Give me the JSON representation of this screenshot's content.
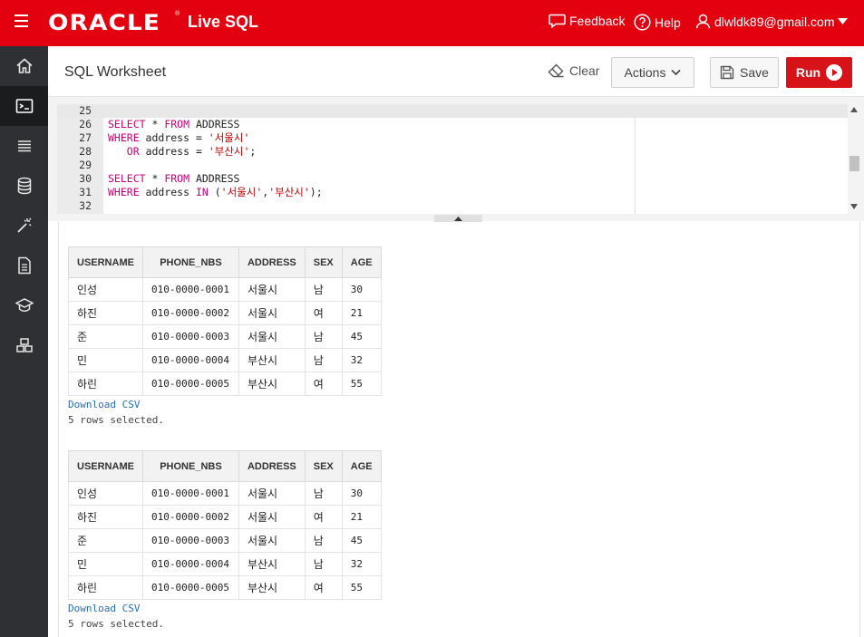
{
  "topbar": {
    "brand": "ORACLE",
    "brand_reg": "®",
    "product": "Live SQL",
    "feedback": "Feedback",
    "help": "Help",
    "user": "dlwldk89@gmail.com"
  },
  "sidebar": {
    "items": [
      {
        "name": "home",
        "icon": "home-icon"
      },
      {
        "name": "sql-worksheet",
        "icon": "terminal-icon",
        "active": true
      },
      {
        "name": "my-session",
        "icon": "list-icon"
      },
      {
        "name": "schema",
        "icon": "database-icon"
      },
      {
        "name": "quick-sql",
        "icon": "magic-wand-icon"
      },
      {
        "name": "my-scripts",
        "icon": "document-icon"
      },
      {
        "name": "tutorials",
        "icon": "graduation-cap-icon"
      },
      {
        "name": "code-library",
        "icon": "blocks-icon"
      }
    ]
  },
  "header": {
    "title": "SQL Worksheet",
    "clear": "Clear",
    "actions": "Actions",
    "save": "Save",
    "run": "Run"
  },
  "editor": {
    "lines": [
      {
        "num": "25",
        "code": ""
      },
      {
        "num": "26",
        "code": "SELECT * FROM ADDRESS"
      },
      {
        "num": "27",
        "code": "WHERE address = '서울시'"
      },
      {
        "num": "28",
        "code": "   OR address = '부산시';"
      },
      {
        "num": "29",
        "code": ""
      },
      {
        "num": "30",
        "code": "SELECT * FROM ADDRESS"
      },
      {
        "num": "31",
        "code": "WHERE address IN ('서울시','부산시');"
      },
      {
        "num": "32",
        "code": ""
      }
    ]
  },
  "results": [
    {
      "columns": [
        "USERNAME",
        "PHONE_NBS",
        "ADDRESS",
        "SEX",
        "AGE"
      ],
      "rows": [
        [
          "인성",
          "010-0000-0001",
          "서울시",
          "남",
          "30"
        ],
        [
          "하진",
          "010-0000-0002",
          "서울시",
          "여",
          "21"
        ],
        [
          "준",
          "010-0000-0003",
          "서울시",
          "남",
          "45"
        ],
        [
          "민",
          "010-0000-0004",
          "부산시",
          "남",
          "32"
        ],
        [
          "하린",
          "010-0000-0005",
          "부산시",
          "여",
          "55"
        ]
      ],
      "download": "Download CSV",
      "message": "5 rows selected."
    },
    {
      "columns": [
        "USERNAME",
        "PHONE_NBS",
        "ADDRESS",
        "SEX",
        "AGE"
      ],
      "rows": [
        [
          "인성",
          "010-0000-0001",
          "서울시",
          "남",
          "30"
        ],
        [
          "하진",
          "010-0000-0002",
          "서울시",
          "여",
          "21"
        ],
        [
          "준",
          "010-0000-0003",
          "서울시",
          "남",
          "45"
        ],
        [
          "민",
          "010-0000-0004",
          "부산시",
          "남",
          "32"
        ],
        [
          "하린",
          "010-0000-0005",
          "부산시",
          "여",
          "55"
        ]
      ],
      "download": "Download CSV",
      "message": "5 rows selected."
    }
  ],
  "colors": {
    "brand_red": "#e3000f",
    "run_red": "#d81219",
    "sidebar": "#2e3033",
    "keyword": "#cc0077",
    "string": "#c00000",
    "link": "#2a6ebb"
  }
}
